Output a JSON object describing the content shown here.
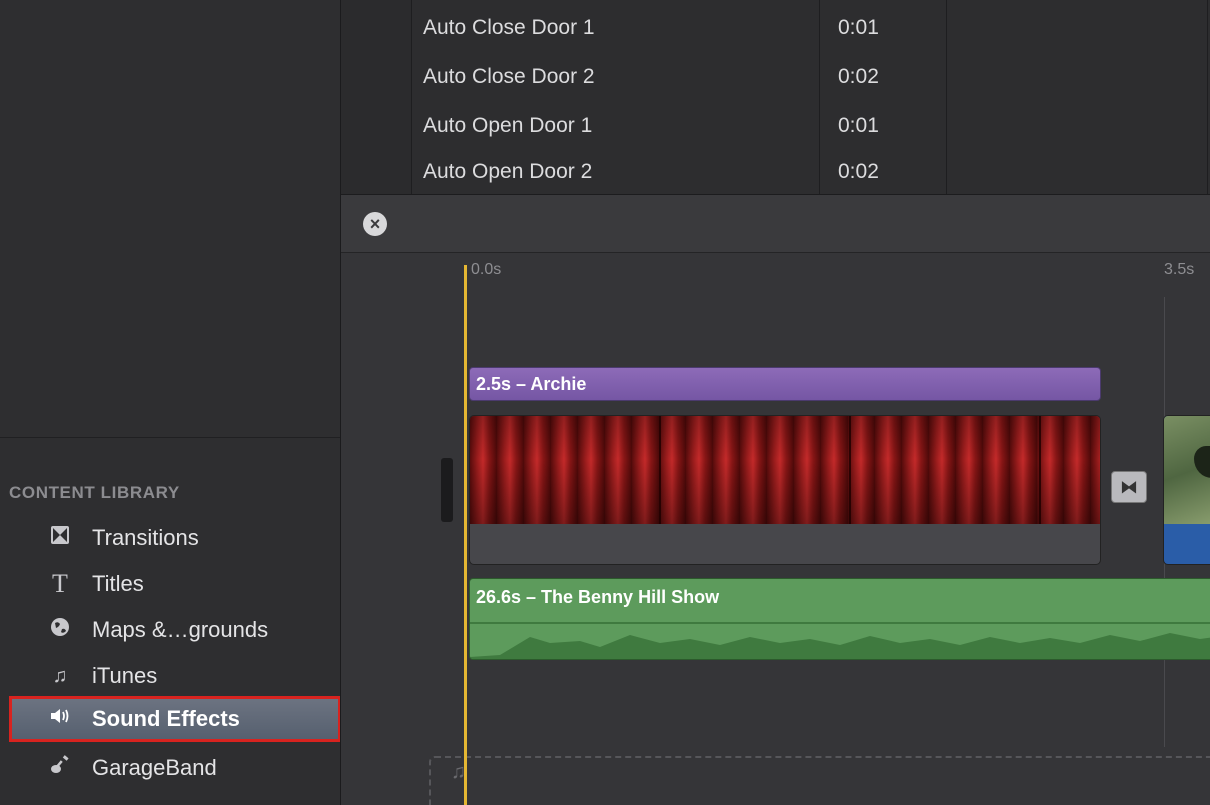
{
  "sidebar": {
    "section_title": "CONTENT LIBRARY",
    "items": [
      {
        "label": "Transitions",
        "icon": "transitions-icon",
        "selected": false
      },
      {
        "label": "Titles",
        "icon": "titles-icon",
        "selected": false
      },
      {
        "label": "Maps &…grounds",
        "icon": "globe-icon",
        "selected": false
      },
      {
        "label": "iTunes",
        "icon": "music-note-icon",
        "selected": false
      },
      {
        "label": "Sound Effects",
        "icon": "speaker-icon",
        "selected": true
      },
      {
        "label": "GarageBand",
        "icon": "guitar-icon",
        "selected": false
      }
    ]
  },
  "browser": {
    "rows": [
      {
        "name": "Auto Close Door 1",
        "duration": "0:01"
      },
      {
        "name": "Auto Close Door 2",
        "duration": "0:02"
      },
      {
        "name": "Auto Open Door 1",
        "duration": "0:01"
      },
      {
        "name": "Auto Open Door 2",
        "duration": "0:02"
      }
    ]
  },
  "timeline": {
    "ruler": {
      "start_label": "0.0s",
      "end_label": "3.5s"
    },
    "title_clip": {
      "label": "2.5s – Archie",
      "color": "#7e5fae"
    },
    "audio_clip": {
      "label": "26.6s – The Benny Hill Show",
      "color": "#5d9b5c"
    }
  },
  "colors": {
    "playhead": "#e5b733",
    "selection_border": "#d8231f"
  }
}
